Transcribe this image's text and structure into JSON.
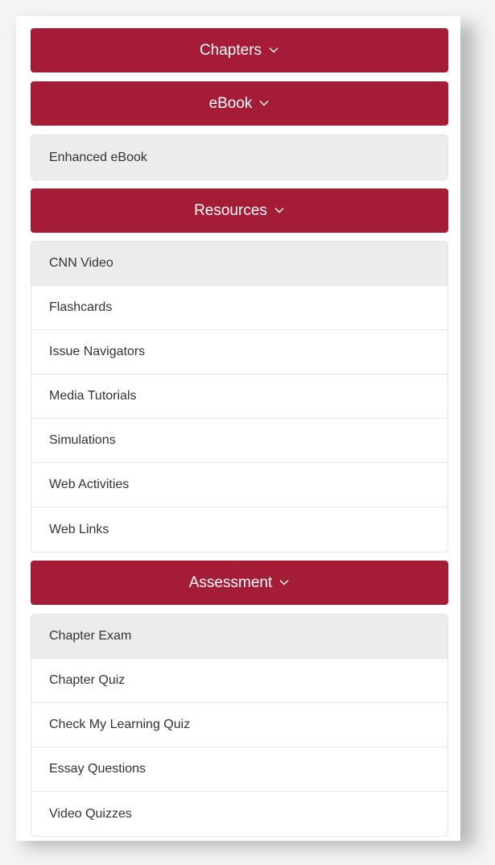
{
  "accent_color": "#a51c36",
  "chevron_icon": "chevron-down-icon",
  "sections": {
    "chapters": {
      "label": "Chapters"
    },
    "ebook": {
      "label": "eBook",
      "items": [
        "Enhanced eBook"
      ]
    },
    "resources": {
      "label": "Resources",
      "items": [
        "CNN Video",
        "Flashcards",
        "Issue Navigators",
        "Media Tutorials",
        "Simulations",
        "Web Activities",
        "Web Links"
      ]
    },
    "assessment": {
      "label": "Assessment",
      "items": [
        "Chapter Exam",
        "Chapter Quiz",
        "Check My Learning Quiz",
        "Essay Questions",
        "Video Quizzes"
      ]
    }
  }
}
